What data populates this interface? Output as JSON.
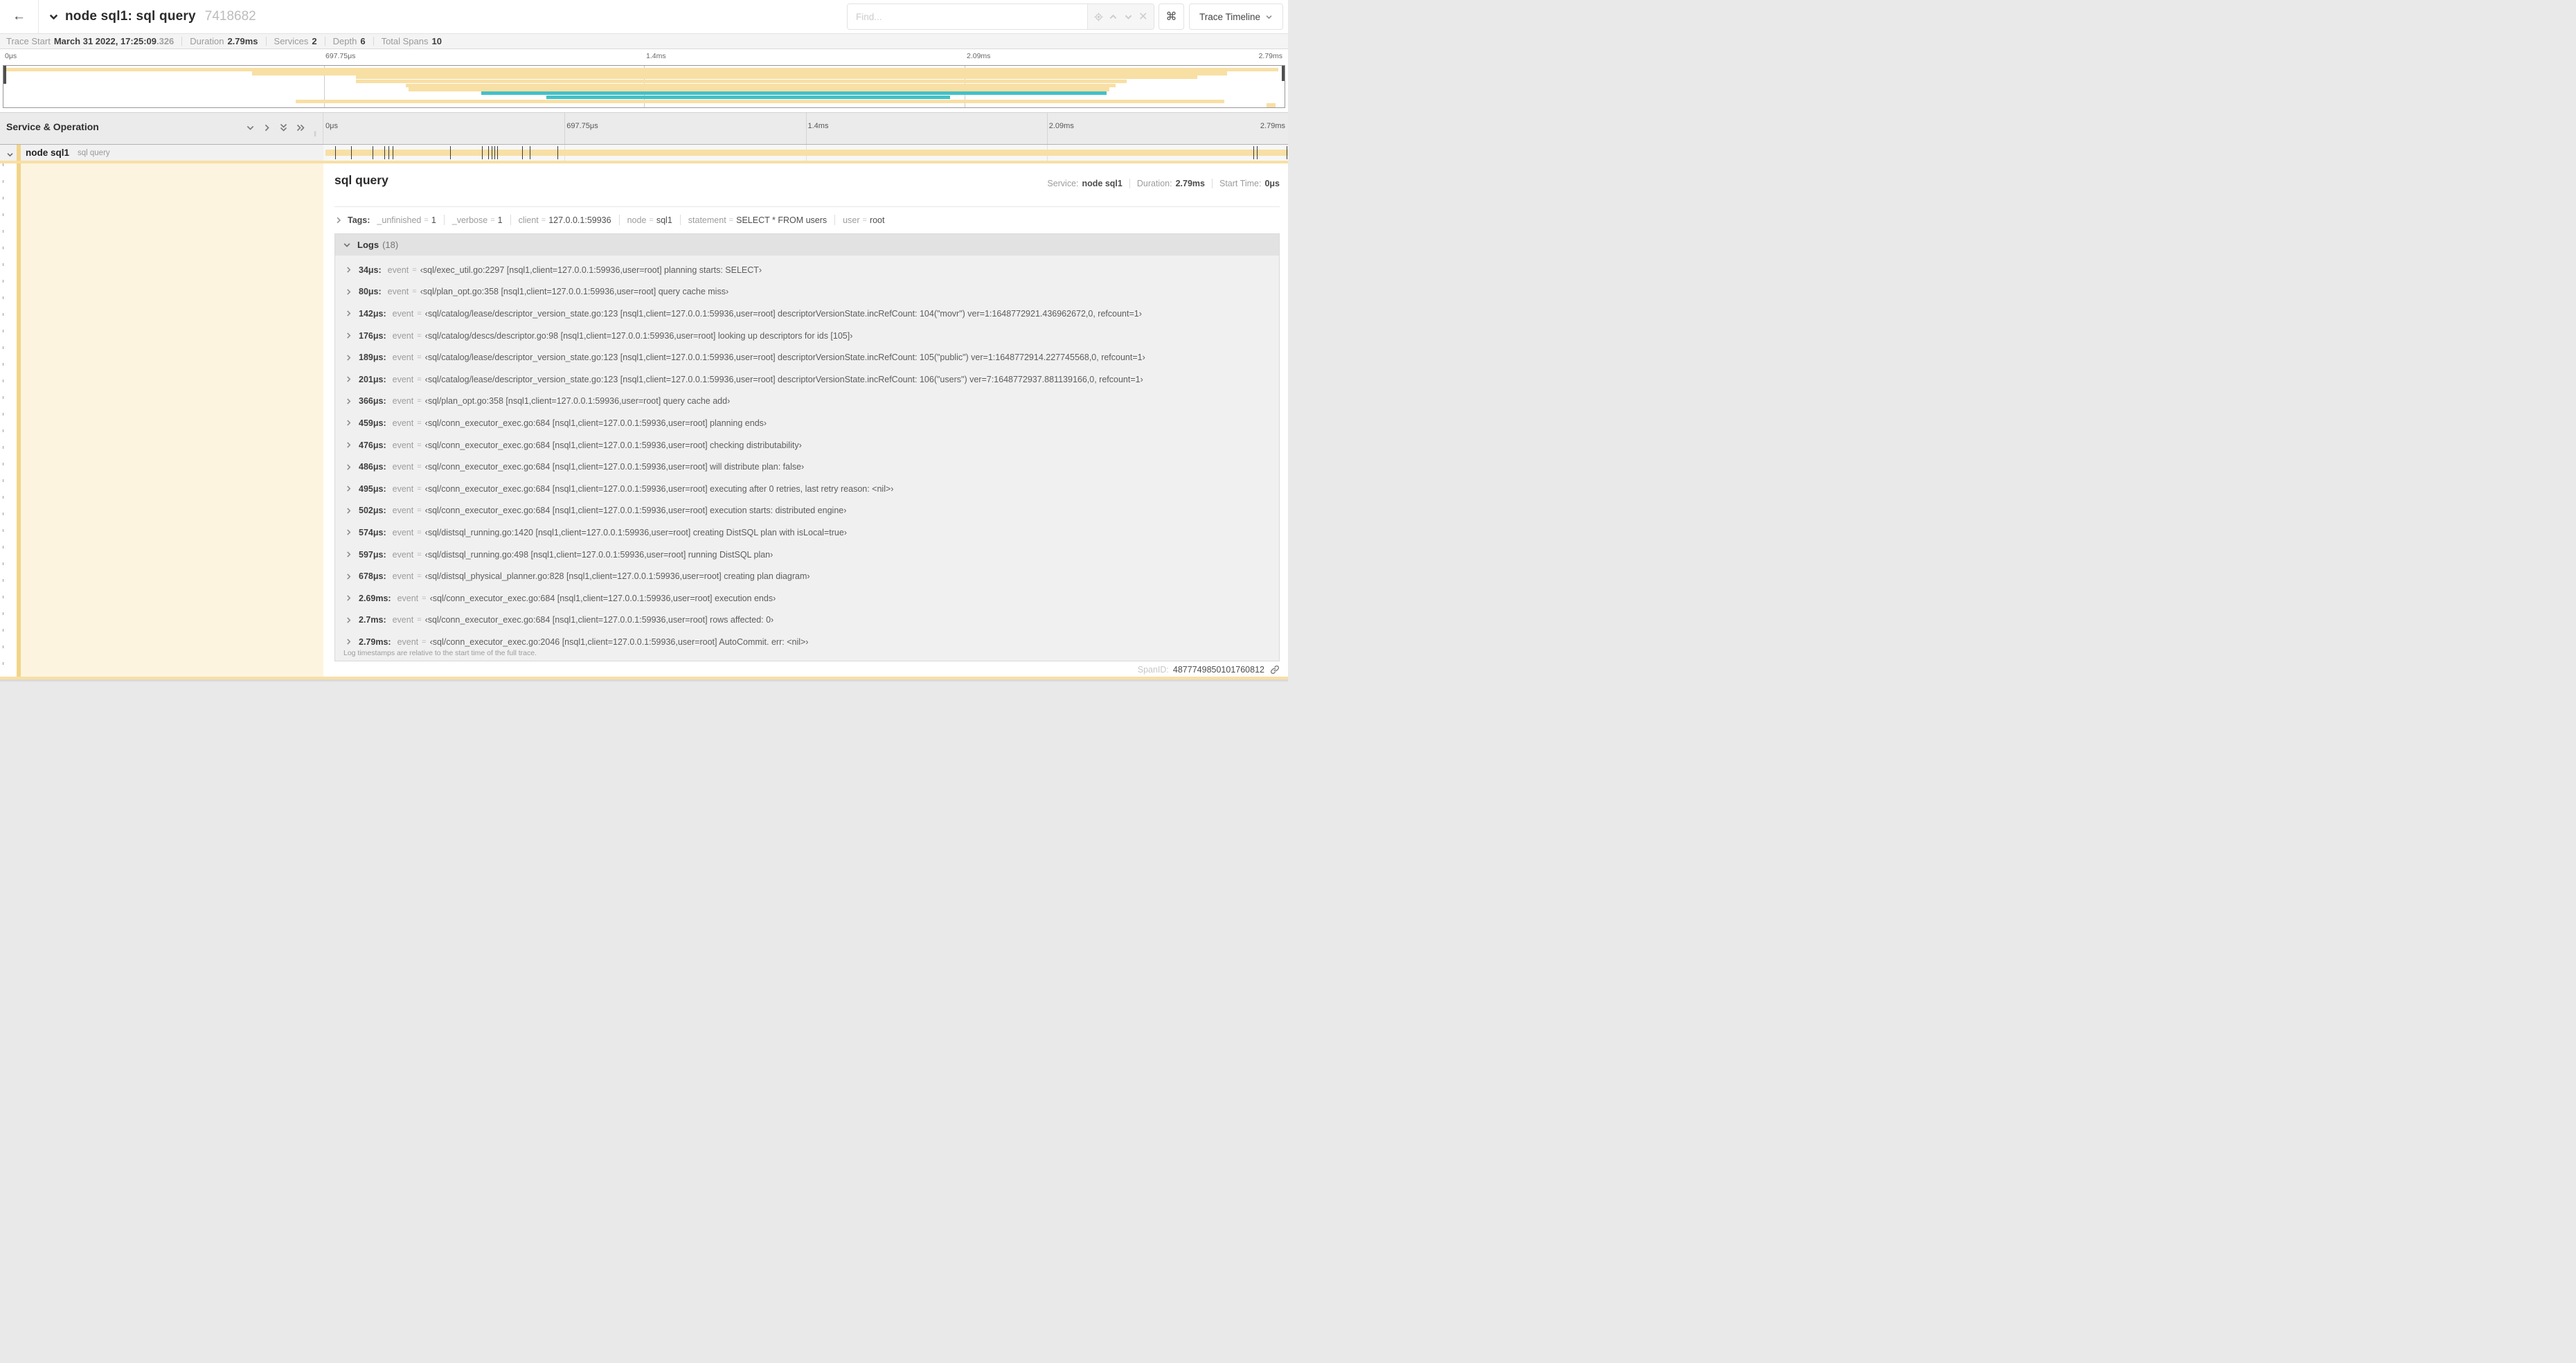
{
  "colors": {
    "span_yellow": "#F8DFA4",
    "span_teal": "#44C0C7",
    "stripe_tan": "#F2D489",
    "detail_tint": "rgba(248,223,164,0.34)"
  },
  "icons": {
    "back": "←",
    "command": "⌘",
    "close": "✕",
    "resize_grip": "‖"
  },
  "header": {
    "title": "node sql1: sql query",
    "trace_id": "7418682",
    "find_placeholder": "Find...",
    "view_selector_label": "Trace Timeline"
  },
  "summary": {
    "trace_start_label": "Trace Start",
    "trace_start_value": "March 31 2022, 17:25:09",
    "trace_start_ms": ".326",
    "duration_label": "Duration",
    "duration_value": "2.79ms",
    "services_label": "Services",
    "services_value": "2",
    "depth_label": "Depth",
    "depth_value": "6",
    "total_spans_label": "Total Spans",
    "total_spans_value": "10"
  },
  "timeline_ticks": [
    {
      "label": "0μs",
      "pos": 0
    },
    {
      "label": "697.75μs",
      "pos": 25
    },
    {
      "label": "1.4ms",
      "pos": 50
    },
    {
      "label": "2.09ms",
      "pos": 75
    },
    {
      "label": "2.79ms",
      "pos": 100
    }
  ],
  "minimap": {
    "rows": [
      {
        "color": "yellow",
        "start": 0.2,
        "end": 99.5
      },
      {
        "color": "yellow",
        "start": 19.4,
        "end": 95.5
      },
      {
        "color": "yellow",
        "start": 27.5,
        "end": 93.2
      },
      {
        "color": "yellow",
        "start": 27.5,
        "end": 87.7
      },
      {
        "color": "yellow",
        "start": 31.4,
        "end": 86.8
      },
      {
        "color": "yellow",
        "start": 31.6,
        "end": 86.3
      },
      {
        "color": "teal",
        "start": 37.3,
        "end": 86.1
      },
      {
        "color": "teal",
        "start": 42.4,
        "end": 73.9
      },
      {
        "color": "yellow",
        "start": 22.8,
        "end": 95.3
      },
      {
        "color": "yellow",
        "start": 98.6,
        "end": 99.3
      }
    ]
  },
  "grid_header": {
    "left_title": "Service & Operation"
  },
  "span_row": {
    "service": "node sql1",
    "operation": "sql query",
    "bar_start_pct": 0.2,
    "bar_end_pct": 100,
    "marker_pcts": [
      1.22,
      2.87,
      5.09,
      6.31,
      6.77,
      7.2,
      13.12,
      16.45,
      17.06,
      17.42,
      17.74,
      17.99,
      20.57,
      21.4,
      24.3,
      96.42,
      96.77,
      99.85
    ]
  },
  "detail": {
    "title": "sql query",
    "service_label": "Service:",
    "service_value": "node sql1",
    "duration_label": "Duration:",
    "duration_value": "2.79ms",
    "start_time_label": "Start Time:",
    "start_time_value": "0μs",
    "tags_label": "Tags:",
    "tags": [
      {
        "key": "_unfinished",
        "value": "1"
      },
      {
        "key": "_verbose",
        "value": "1"
      },
      {
        "key": "client",
        "value": "127.0.0.1:59936"
      },
      {
        "key": "node",
        "value": "sql1"
      },
      {
        "key": "statement",
        "value": "SELECT * FROM users"
      },
      {
        "key": "user",
        "value": "root"
      }
    ],
    "logs_label": "Logs",
    "logs_count": "(18)",
    "event_key": "event",
    "eq": "=",
    "logs": [
      {
        "time": "34μs:",
        "message": "‹sql/exec_util.go:2297 [nsql1,client=127.0.0.1:59936,user=root] planning starts: SELECT›"
      },
      {
        "time": "80μs:",
        "message": "‹sql/plan_opt.go:358 [nsql1,client=127.0.0.1:59936,user=root] query cache miss›"
      },
      {
        "time": "142μs:",
        "message": "‹sql/catalog/lease/descriptor_version_state.go:123 [nsql1,client=127.0.0.1:59936,user=root] descriptorVersionState.incRefCount: 104(\"movr\") ver=1:1648772921.436962672,0, refcount=1›"
      },
      {
        "time": "176μs:",
        "message": "‹sql/catalog/descs/descriptor.go:98 [nsql1,client=127.0.0.1:59936,user=root] looking up descriptors for ids [105]›"
      },
      {
        "time": "189μs:",
        "message": "‹sql/catalog/lease/descriptor_version_state.go:123 [nsql1,client=127.0.0.1:59936,user=root] descriptorVersionState.incRefCount: 105(\"public\") ver=1:1648772914.227745568,0, refcount=1›"
      },
      {
        "time": "201μs:",
        "message": "‹sql/catalog/lease/descriptor_version_state.go:123 [nsql1,client=127.0.0.1:59936,user=root] descriptorVersionState.incRefCount: 106(\"users\") ver=7:1648772937.881139166,0, refcount=1›"
      },
      {
        "time": "366μs:",
        "message": "‹sql/plan_opt.go:358 [nsql1,client=127.0.0.1:59936,user=root] query cache add›"
      },
      {
        "time": "459μs:",
        "message": "‹sql/conn_executor_exec.go:684 [nsql1,client=127.0.0.1:59936,user=root] planning ends›"
      },
      {
        "time": "476μs:",
        "message": "‹sql/conn_executor_exec.go:684 [nsql1,client=127.0.0.1:59936,user=root] checking distributability›"
      },
      {
        "time": "486μs:",
        "message": "‹sql/conn_executor_exec.go:684 [nsql1,client=127.0.0.1:59936,user=root] will distribute plan: false›"
      },
      {
        "time": "495μs:",
        "message": "‹sql/conn_executor_exec.go:684 [nsql1,client=127.0.0.1:59936,user=root] executing after 0 retries, last retry reason: <nil>›"
      },
      {
        "time": "502μs:",
        "message": "‹sql/conn_executor_exec.go:684 [nsql1,client=127.0.0.1:59936,user=root] execution starts: distributed engine›"
      },
      {
        "time": "574μs:",
        "message": "‹sql/distsql_running.go:1420 [nsql1,client=127.0.0.1:59936,user=root] creating DistSQL plan with isLocal=true›"
      },
      {
        "time": "597μs:",
        "message": "‹sql/distsql_running.go:498 [nsql1,client=127.0.0.1:59936,user=root] running DistSQL plan›"
      },
      {
        "time": "678μs:",
        "message": "‹sql/distsql_physical_planner.go:828 [nsql1,client=127.0.0.1:59936,user=root] creating plan diagram›"
      },
      {
        "time": "2.69ms:",
        "message": "‹sql/conn_executor_exec.go:684 [nsql1,client=127.0.0.1:59936,user=root] execution ends›"
      },
      {
        "time": "2.7ms:",
        "message": "‹sql/conn_executor_exec.go:684 [nsql1,client=127.0.0.1:59936,user=root] rows affected: 0›"
      },
      {
        "time": "2.79ms:",
        "message": "‹sql/conn_executor_exec.go:2046 [nsql1,client=127.0.0.1:59936,user=root] AutoCommit. err: <nil>›"
      }
    ],
    "footer_note": "Log timestamps are relative to the start time of the full trace.",
    "span_id_label": "SpanID:",
    "span_id_value": "4877749850101760812"
  }
}
